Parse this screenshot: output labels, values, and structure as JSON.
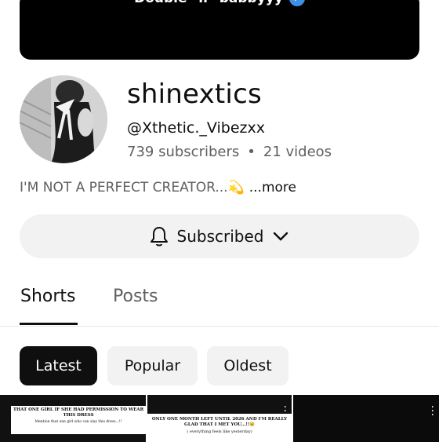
{
  "banner": {
    "text": "Double \"ii\" babbyyy"
  },
  "channel": {
    "name": "shinextics",
    "handle": "@Xthetic._Vibezxx",
    "subscribers": "739 subscribers",
    "videos": "21 videos",
    "separator": "•",
    "description": "I'M NOT A PERFECT CREATOR...💫",
    "more_label": "...more"
  },
  "subscribe_button": {
    "label": "Subscribed"
  },
  "tabs": [
    {
      "label": "Shorts",
      "active": true
    },
    {
      "label": "Posts",
      "active": false
    }
  ],
  "filters": [
    {
      "label": "Latest",
      "selected": true
    },
    {
      "label": "Popular",
      "selected": false
    },
    {
      "label": "Oldest",
      "selected": false
    }
  ],
  "shorts": [
    {
      "caption": "THAT ONE GIRL IF SHE HAD PERMISSION TO WEAR THIS DRESS",
      "subcaption": "Mention that one girl who can slay this dress...!!"
    },
    {
      "caption": "ONLY ONE MONTH LEFT UNTIL 2026 AND I'M REALLY GLAD THAT I MET YOU...!!🥹",
      "subcaption": "( everything feels like yesterday)"
    },
    {
      "caption": "",
      "subcaption": ""
    }
  ],
  "icons": {
    "verified": "verified-badge-icon",
    "bell": "bell-icon",
    "chevron": "chevron-down-icon",
    "kebab": "more-vert-icon"
  },
  "colors": {
    "verified": "#3d8fe8",
    "chip_selected": "#0f0f0f",
    "chip_default": "#f2f2f2"
  }
}
